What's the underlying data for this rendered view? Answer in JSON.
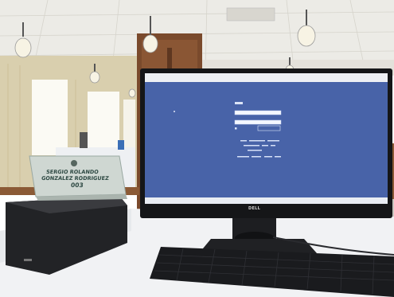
{
  "scene": {
    "name_card": {
      "line1": "SERGIO ROLANDO",
      "line2": "GONZALEZ RODRIGUEZ",
      "number": "003"
    },
    "monitor": {
      "brand": "DELL"
    }
  },
  "colors": {
    "screen_blue": "#4863a8",
    "screen_bezel": "#151618",
    "ceiling": "#ecebe6",
    "wood": "#7a4a2c",
    "table_cloth": "#f1f2f4",
    "keyboard": "#1a1b1e",
    "pc_case": "#222326"
  }
}
